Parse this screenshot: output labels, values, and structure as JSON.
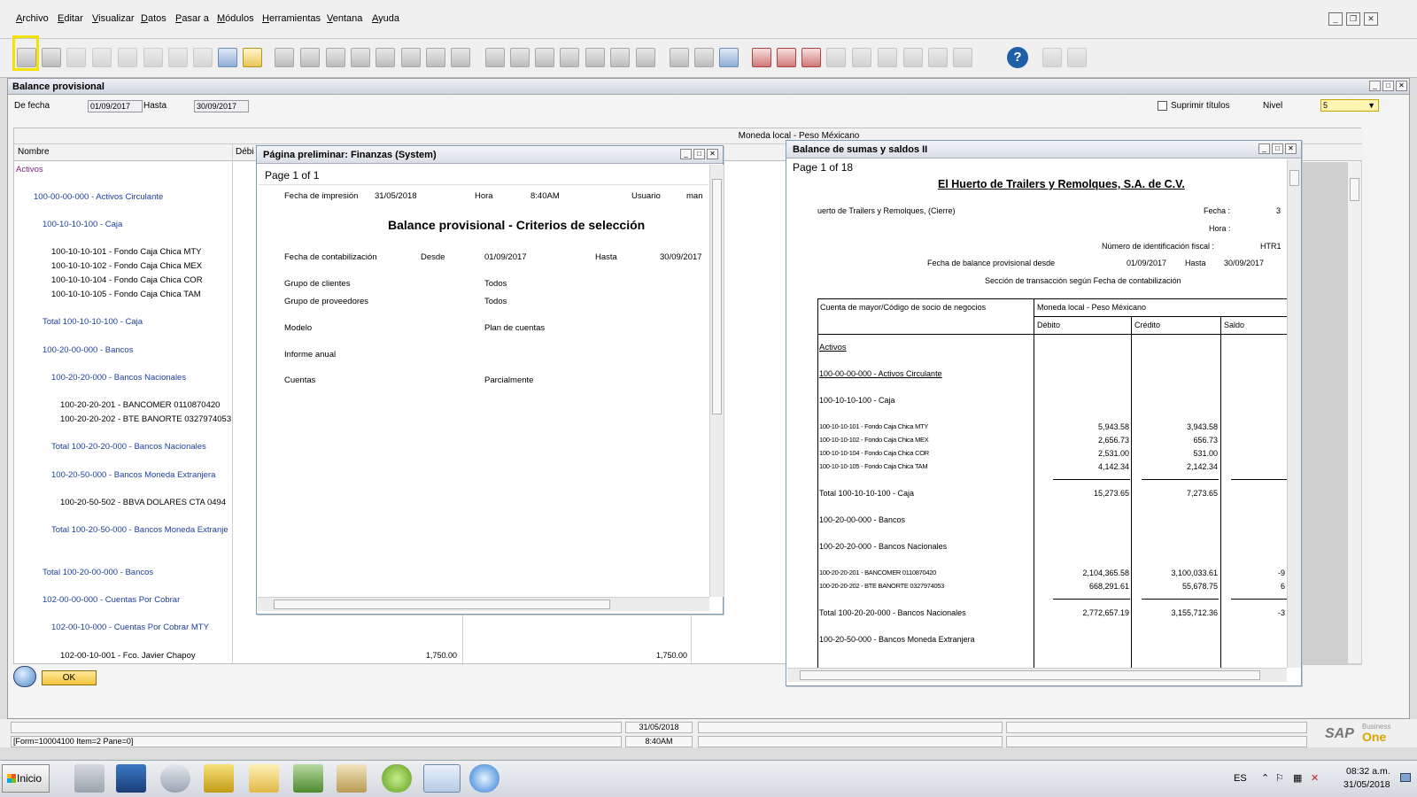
{
  "menu": [
    "Archivo",
    "Editar",
    "Visualizar",
    "Datos",
    "Pasar a",
    "Módulos",
    "Herramientas",
    "Ventana",
    "Ayuda"
  ],
  "window": {
    "title": "Balance provisional",
    "from_label": "De fecha",
    "from_value": "01/09/2017",
    "to_label": "Hasta",
    "to_value": "30/09/2017",
    "suppress_label": "Suprimir títulos",
    "level_label": "Nivel",
    "level_value": "5"
  },
  "table": {
    "currency_header": "Moneda local - Peso Méxicano",
    "name_header": "Nombre",
    "debit_header_partial": "Débi",
    "rows": [
      {
        "text": "Activos",
        "color": "purple",
        "debit": "",
        "credit": ""
      },
      {
        "text": "100-00-00-000 - Activos Circulante",
        "color": "blue",
        "debit": "",
        "credit": ""
      },
      {
        "text": "100-10-10-100 - Caja",
        "color": "blue",
        "debit": "",
        "credit": ""
      },
      {
        "text": "100-10-10-101 - Fondo Caja Chica MTY",
        "color": "black",
        "debit": "",
        "credit": ""
      },
      {
        "text": "100-10-10-102 - Fondo Caja Chica MEX",
        "color": "black",
        "debit": "",
        "credit": ""
      },
      {
        "text": "100-10-10-104 - Fondo Caja Chica COR",
        "color": "black",
        "debit": "",
        "credit": ""
      },
      {
        "text": "100-10-10-105 - Fondo Caja Chica TAM",
        "color": "black",
        "debit": "",
        "credit": ""
      },
      {
        "text": "Total 100-10-10-100 - Caja",
        "color": "blue",
        "debit": "",
        "credit": ""
      },
      {
        "text": "100-20-00-000 - Bancos",
        "color": "blue",
        "debit": "",
        "credit": ""
      },
      {
        "text": "100-20-20-000 - Bancos Nacionales",
        "color": "blue",
        "debit": "",
        "credit": ""
      },
      {
        "text": "100-20-20-201 - BANCOMER  0110870420",
        "color": "black",
        "debit": "",
        "credit": ""
      },
      {
        "text": "100-20-20-202 - BTE BANORTE 0327974053",
        "color": "black",
        "debit": "",
        "credit": ""
      },
      {
        "text": "Total 100-20-20-000 - Bancos Nacionales",
        "color": "blue",
        "debit": "",
        "credit": ""
      },
      {
        "text": "100-20-50-000 - Bancos Moneda Extranjera",
        "color": "blue",
        "debit": "",
        "credit": ""
      },
      {
        "text": "100-20-50-502 - BBVA DOLARES CTA 0494",
        "color": "black",
        "debit": "",
        "credit": ""
      },
      {
        "text": "Total 100-20-50-000 - Bancos Moneda Extranje",
        "color": "blue",
        "debit": "",
        "credit": ""
      },
      {
        "text": "Total 100-20-00-000 - Bancos",
        "color": "blue",
        "debit": "",
        "credit": ""
      },
      {
        "text": "102-00-00-000 - Cuentas Por Cobrar",
        "color": "blue",
        "debit": "",
        "credit": ""
      },
      {
        "text": "102-00-10-000 - Cuentas Por Cobrar MTY",
        "color": "blue",
        "debit": "",
        "credit": ""
      },
      {
        "text": "102-00-10-001 - Fco. Javier Chapoy",
        "color": "black",
        "debit": "1,750.00",
        "credit": "1,750.00"
      }
    ]
  },
  "ok_label": "OK",
  "preview1": {
    "title": "Página preliminar: Finanzas (System)",
    "page": "Page 1 of 1",
    "print_date_label": "Fecha de impresión",
    "print_date": "31/05/2018",
    "hour_label": "Hora",
    "hour": "8:40AM",
    "user_label": "Usuario",
    "user": "man",
    "heading": "Balance provisional - Criterios de selección",
    "post_label": "Fecha de contabilización",
    "desde_label": "Desde",
    "desde": "01/09/2017",
    "hasta_label": "Hasta",
    "hasta": "30/09/2017",
    "criteria": [
      {
        "label": "Grupo de clientes",
        "value": "Todos"
      },
      {
        "label": "Grupo de proveedores",
        "value": "Todos"
      },
      {
        "label": "Modelo",
        "value": "Plan de cuentas"
      },
      {
        "label": "Informe anual",
        "value": ""
      },
      {
        "label": "Cuentas",
        "value": "Parcialmente"
      }
    ]
  },
  "preview2": {
    "title": "Balance de sumas y saldos II",
    "page": "Page 1 of 18",
    "company": "El Huerto de Trailers y Remolques, S.A. de C.V.",
    "db": "uerto de Trailers y Remolques, (Cierre)",
    "fecha_label": "Fecha :",
    "fecha_val": "3",
    "hora_label": "Hora :",
    "nif_label": "Número de identificación fiscal :",
    "nif_val": "HTR1",
    "range_label": "Fecha de balance provisional desde",
    "range_from": "01/09/2017",
    "range_to_label": "Hasta",
    "range_to": "30/09/2017",
    "section_label": "Sección de transacción según  Fecha de contabilización",
    "col_account": "Cuenta de mayor/Código de socio de negocios",
    "col_currency": "Moneda local - Peso Méxicano",
    "col_debit": "Débito",
    "col_credit": "Crédito",
    "col_balance": "Saldo",
    "rows": [
      {
        "text": "Activos",
        "debit": "",
        "credit": "",
        "balance": "",
        "u": true
      },
      {
        "text": "100-00-00-000 - Activos Circulante",
        "debit": "",
        "credit": "",
        "balance": "",
        "u": true
      },
      {
        "text": "100-10-10-100 - Caja",
        "debit": "",
        "credit": "",
        "balance": ""
      },
      {
        "text": "100-10-10-101 - Fondo Caja Chica MTY",
        "debit": "5,943.58",
        "credit": "3,943.58",
        "balance": "",
        "s": true
      },
      {
        "text": "100-10-10-102 - Fondo Caja Chica MEX",
        "debit": "2,656.73",
        "credit": "656.73",
        "balance": "",
        "s": true
      },
      {
        "text": "100-10-10-104 - Fondo Caja Chica COR",
        "debit": "2,531.00",
        "credit": "531.00",
        "balance": "",
        "s": true
      },
      {
        "text": "100-10-10-105 - Fondo Caja Chica TAM",
        "debit": "4,142.34",
        "credit": "2,142.34",
        "balance": "",
        "s": true
      },
      {
        "text": "Total 100-10-10-100 - Caja",
        "debit": "15,273.65",
        "credit": "7,273.65",
        "balance": ""
      },
      {
        "text": "100-20-00-000 - Bancos",
        "debit": "",
        "credit": "",
        "balance": ""
      },
      {
        "text": "100-20-20-000 - Bancos Nacionales",
        "debit": "",
        "credit": "",
        "balance": ""
      },
      {
        "text": "100-20-20-201 - BANCOMER 0110870420",
        "debit": "2,104,365.58",
        "credit": "3,100,033.61",
        "balance": "-9",
        "s": true
      },
      {
        "text": "100-20-20-202 - BTE BANORTE 0327974053",
        "debit": "668,291.61",
        "credit": "55,678.75",
        "balance": "6",
        "s": true
      },
      {
        "text": "Total 100-20-20-000 - Bancos Nacionales",
        "debit": "2,772,657.19",
        "credit": "3,155,712.36",
        "balance": "-3"
      },
      {
        "text": "100-20-50-000 - Bancos Moneda Extranjera",
        "debit": "",
        "credit": "",
        "balance": ""
      }
    ]
  },
  "status": {
    "form": "[Form=10004100 Item=2 Pane=0]",
    "date": "31/05/2018",
    "time": "8:40AM",
    "brand": "SAP",
    "brand2": "Business",
    "brand3": "One"
  },
  "taskbar": {
    "start": "Inicio",
    "lang": "ES",
    "clock_time": "08:32 a.m.",
    "clock_date": "31/05/2018"
  }
}
